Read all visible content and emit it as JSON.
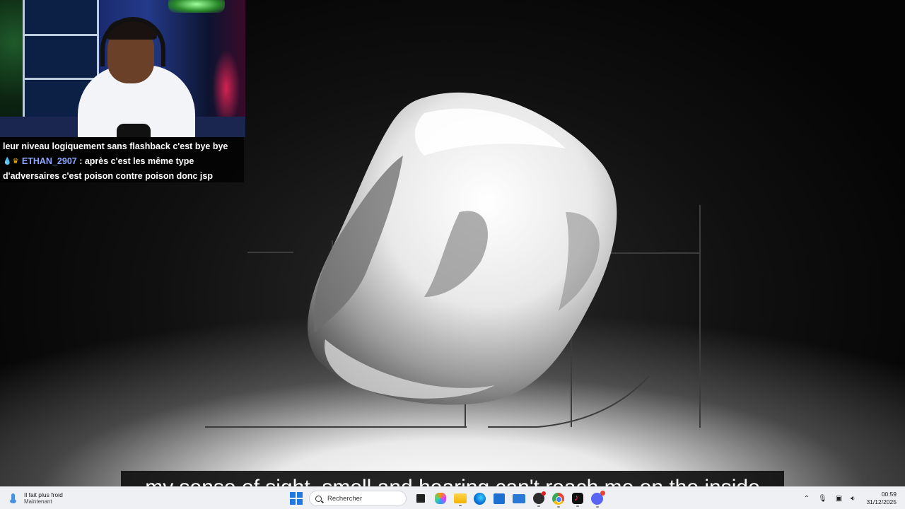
{
  "chat": {
    "line1": "leur niveau logiquement sans flashback c'est bye bye",
    "badge1_icon": "drop-badge-icon",
    "badge2_icon": "crown-badge-icon",
    "username": "ETHAN_2907",
    "message_part1": " : après c'est les même type",
    "message_part2": "d'adversaires c'est poison contre poison donc jsp"
  },
  "subtitle": {
    "text": "my sense of sight, smell and hearing can't reach me on the inside"
  },
  "taskbar": {
    "weather_title": "Il fait plus froid",
    "weather_subtitle": "Maintenant",
    "search_placeholder": "Rechercher",
    "time": "00:59",
    "date": "31/12/2025",
    "icons": [
      "windows-start-icon",
      "search-icon",
      "task-view-icon",
      "copilot-icon",
      "file-explorer-icon",
      "edge-browser-icon",
      "microsoft-store-icon",
      "mail-icon",
      "obs-icon",
      "chrome-icon",
      "tiktok-icon",
      "discord-icon"
    ],
    "tray_icons": [
      "chevron-up-icon",
      "microphone-icon",
      "network-icon",
      "volume-icon"
    ]
  },
  "colors": {
    "chat_username": "#8ea8ff",
    "taskbar_bg": "#eef0f4",
    "windows_blue": "#1f7ae0"
  }
}
